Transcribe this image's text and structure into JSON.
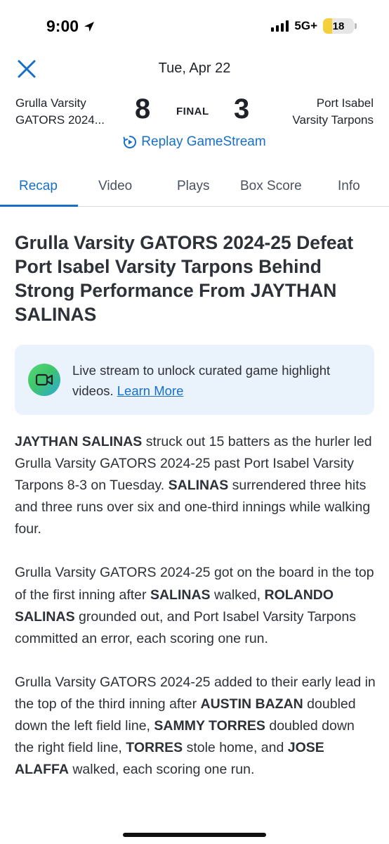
{
  "status_bar": {
    "time": "9:00",
    "network": "5G+",
    "battery_level": "18"
  },
  "header": {
    "date": "Tue, Apr 22"
  },
  "scoreboard": {
    "home_team_line1": "Grulla Varsity",
    "home_team_line2": "GATORS 2024...",
    "home_score": "8",
    "status": "FINAL",
    "away_score": "3",
    "away_team_line1": "Port Isabel",
    "away_team_line2": "Varsity Tarpons",
    "replay_label": "Replay GameStream"
  },
  "tabs": [
    {
      "label": "Recap",
      "active": true
    },
    {
      "label": "Video",
      "active": false
    },
    {
      "label": "Plays",
      "active": false
    },
    {
      "label": "Box Score",
      "active": false
    },
    {
      "label": "Info",
      "active": false
    }
  ],
  "recap": {
    "headline": "Grulla Varsity GATORS 2024-25 Defeat Port Isabel Varsity Tarpons Behind Strong Performance From JAYTHAN SALINAS",
    "banner_text": "Live stream to unlock curated game highlight videos.",
    "banner_link": "Learn More",
    "paragraphs": [
      [
        {
          "text": "JAYTHAN SALINAS",
          "bold": true
        },
        {
          "text": " struck out 15 batters as the hurler led Grulla Varsity GATORS 2024-25 past Port Isabel Varsity Tarpons 8-3 on Tuesday. ",
          "bold": false
        },
        {
          "text": "SALINAS",
          "bold": true
        },
        {
          "text": " surrendered three hits and three runs over six and one-third innings while walking four.",
          "bold": false
        }
      ],
      [
        {
          "text": "Grulla Varsity GATORS 2024-25 got on the board in the top of the first inning after ",
          "bold": false
        },
        {
          "text": "SALINAS",
          "bold": true
        },
        {
          "text": " walked, ",
          "bold": false
        },
        {
          "text": "ROLANDO SALINAS",
          "bold": true
        },
        {
          "text": " grounded out, and Port Isabel Varsity Tarpons committed an error, each scoring one run.",
          "bold": false
        }
      ],
      [
        {
          "text": "Grulla Varsity GATORS 2024-25 added to their early lead in the top of the third inning after ",
          "bold": false
        },
        {
          "text": "AUSTIN BAZAN",
          "bold": true
        },
        {
          "text": " doubled down the left field line, ",
          "bold": false
        },
        {
          "text": "SAMMY TORRES",
          "bold": true
        },
        {
          "text": " doubled down the right field line, ",
          "bold": false
        },
        {
          "text": "TORRES",
          "bold": true
        },
        {
          "text": " stole home, and ",
          "bold": false
        },
        {
          "text": "JOSE ALAFFA",
          "bold": true
        },
        {
          "text": " walked, each scoring one run.",
          "bold": false
        }
      ]
    ]
  },
  "colors": {
    "accent": "#1670c9",
    "text": "#2d3138",
    "banner_bg": "#eaf2fb"
  }
}
